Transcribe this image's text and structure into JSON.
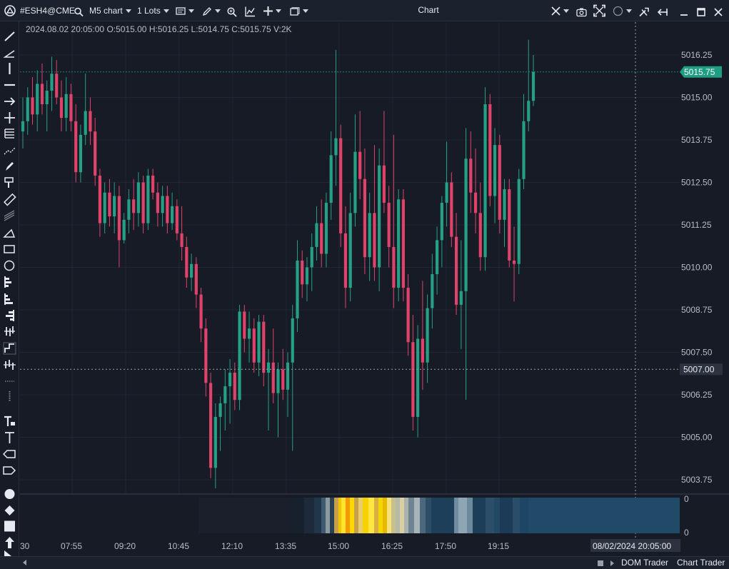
{
  "titlebar": {
    "symbol": "#ESH4@CME",
    "timeframe": "M5 chart",
    "lots": "1 Lots",
    "window_title": "Chart"
  },
  "ohlc_readout": "2024.08.02 20:05:00 O:5015.00 H:5016.25 L:5014.75 C:5015.75 V:2K",
  "price_axis": {
    "ticks": [
      "5016.25",
      "5015.00",
      "5013.75",
      "5012.50",
      "5011.25",
      "5010.00",
      "5008.75",
      "5007.50",
      "5006.25",
      "5005.00",
      "5003.75"
    ],
    "last_price": "5015.75",
    "crosshair_price": "5007.00"
  },
  "time_axis": {
    "ticks": [
      "30",
      "07:55",
      "09:20",
      "10:45",
      "12:10",
      "13:35",
      "15:00",
      "16:25",
      "17:50",
      "19:15"
    ],
    "crosshair_time": "08/02/2024  20:05:00"
  },
  "heatmap_axis": {
    "top": "0",
    "bottom": "0"
  },
  "bottom_tabs": [
    "DOM Trader",
    "Chart Trader"
  ],
  "colors": {
    "up": "#26a085",
    "down": "#e0436a",
    "background": "#161b26",
    "last_price_badge": "#1f9e84"
  },
  "chart_data": {
    "type": "candlestick",
    "ylim": [
      5003.25,
      5016.75
    ],
    "candles_note": "",
    "series": [
      {
        "o": 5014.0,
        "h": 5015.0,
        "l": 5013.5,
        "c": 5014.3
      },
      {
        "o": 5014.3,
        "h": 5015.3,
        "l": 5013.9,
        "c": 5015.0
      },
      {
        "o": 5015.0,
        "h": 5015.6,
        "l": 5014.2,
        "c": 5014.5
      },
      {
        "o": 5014.5,
        "h": 5015.8,
        "l": 5014.0,
        "c": 5015.4
      },
      {
        "o": 5015.4,
        "h": 5016.0,
        "l": 5014.5,
        "c": 5014.8
      },
      {
        "o": 5014.8,
        "h": 5015.5,
        "l": 5014.0,
        "c": 5015.2
      },
      {
        "o": 5015.2,
        "h": 5016.2,
        "l": 5014.6,
        "c": 5015.7
      },
      {
        "o": 5015.7,
        "h": 5016.1,
        "l": 5014.8,
        "c": 5015.0
      },
      {
        "o": 5015.0,
        "h": 5015.5,
        "l": 5014.0,
        "c": 5014.4
      },
      {
        "o": 5014.4,
        "h": 5015.6,
        "l": 5014.0,
        "c": 5015.1
      },
      {
        "o": 5015.1,
        "h": 5015.4,
        "l": 5014.0,
        "c": 5014.3
      },
      {
        "o": 5014.3,
        "h": 5014.8,
        "l": 5012.5,
        "c": 5012.8
      },
      {
        "o": 5012.8,
        "h": 5014.2,
        "l": 5012.5,
        "c": 5013.9
      },
      {
        "o": 5013.9,
        "h": 5015.7,
        "l": 5013.6,
        "c": 5014.6
      },
      {
        "o": 5014.6,
        "h": 5015.0,
        "l": 5013.6,
        "c": 5014.0
      },
      {
        "o": 5014.0,
        "h": 5014.4,
        "l": 5012.4,
        "c": 5012.7
      },
      {
        "o": 5012.7,
        "h": 5012.9,
        "l": 5010.9,
        "c": 5011.3
      },
      {
        "o": 5011.3,
        "h": 5012.5,
        "l": 5011.0,
        "c": 5012.2
      },
      {
        "o": 5012.2,
        "h": 5012.6,
        "l": 5011.2,
        "c": 5011.5
      },
      {
        "o": 5011.5,
        "h": 5012.5,
        "l": 5011.0,
        "c": 5012.1
      },
      {
        "o": 5012.1,
        "h": 5012.4,
        "l": 5010.0,
        "c": 5010.8
      },
      {
        "o": 5010.8,
        "h": 5011.6,
        "l": 5010.7,
        "c": 5011.4
      },
      {
        "o": 5011.4,
        "h": 5012.3,
        "l": 5011.0,
        "c": 5012.0
      },
      {
        "o": 5012.0,
        "h": 5012.6,
        "l": 5011.1,
        "c": 5011.6
      },
      {
        "o": 5011.6,
        "h": 5012.8,
        "l": 5011.2,
        "c": 5012.5
      },
      {
        "o": 5012.5,
        "h": 5012.7,
        "l": 5011.0,
        "c": 5011.3
      },
      {
        "o": 5011.3,
        "h": 5012.9,
        "l": 5011.1,
        "c": 5012.7
      },
      {
        "o": 5012.7,
        "h": 5012.9,
        "l": 5012.0,
        "c": 5012.2
      },
      {
        "o": 5012.2,
        "h": 5012.5,
        "l": 5011.2,
        "c": 5011.6
      },
      {
        "o": 5011.6,
        "h": 5012.4,
        "l": 5011.2,
        "c": 5012.1
      },
      {
        "o": 5012.1,
        "h": 5012.4,
        "l": 5011.0,
        "c": 5011.3
      },
      {
        "o": 5011.3,
        "h": 5012.2,
        "l": 5011.1,
        "c": 5011.8
      },
      {
        "o": 5011.8,
        "h": 5012.0,
        "l": 5010.8,
        "c": 5011.0
      },
      {
        "o": 5011.0,
        "h": 5011.8,
        "l": 5010.2,
        "c": 5010.6
      },
      {
        "o": 5010.6,
        "h": 5010.9,
        "l": 5009.4,
        "c": 5009.7
      },
      {
        "o": 5009.7,
        "h": 5010.4,
        "l": 5009.3,
        "c": 5010.1
      },
      {
        "o": 5010.1,
        "h": 5010.3,
        "l": 5008.8,
        "c": 5009.2
      },
      {
        "o": 5009.2,
        "h": 5009.4,
        "l": 5007.8,
        "c": 5008.2
      },
      {
        "o": 5008.2,
        "h": 5008.5,
        "l": 5006.2,
        "c": 5006.6
      },
      {
        "o": 5006.6,
        "h": 5006.9,
        "l": 5003.8,
        "c": 5004.1
      },
      {
        "o": 5004.1,
        "h": 5006.0,
        "l": 5003.5,
        "c": 5005.6
      },
      {
        "o": 5005.6,
        "h": 5006.2,
        "l": 5004.6,
        "c": 5006.0
      },
      {
        "o": 5006.0,
        "h": 5007.0,
        "l": 5005.2,
        "c": 5006.5
      },
      {
        "o": 5006.5,
        "h": 5007.3,
        "l": 5005.4,
        "c": 5006.9
      },
      {
        "o": 5006.9,
        "h": 5007.2,
        "l": 5005.8,
        "c": 5006.1
      },
      {
        "o": 5006.1,
        "h": 5008.9,
        "l": 5005.8,
        "c": 5008.7
      },
      {
        "o": 5008.7,
        "h": 5008.9,
        "l": 5007.5,
        "c": 5007.9
      },
      {
        "o": 5007.9,
        "h": 5008.7,
        "l": 5007.2,
        "c": 5008.2
      },
      {
        "o": 5008.2,
        "h": 5008.5,
        "l": 5006.9,
        "c": 5007.2
      },
      {
        "o": 5007.2,
        "h": 5008.6,
        "l": 5006.8,
        "c": 5008.4
      },
      {
        "o": 5008.4,
        "h": 5008.6,
        "l": 5006.5,
        "c": 5006.9
      },
      {
        "o": 5006.9,
        "h": 5007.6,
        "l": 5005.2,
        "c": 5007.2
      },
      {
        "o": 5007.2,
        "h": 5008.2,
        "l": 5006.0,
        "c": 5006.3
      },
      {
        "o": 5006.3,
        "h": 5007.2,
        "l": 5005.0,
        "c": 5007.0
      },
      {
        "o": 5007.0,
        "h": 5007.6,
        "l": 5006.1,
        "c": 5006.4
      },
      {
        "o": 5006.4,
        "h": 5007.5,
        "l": 5005.6,
        "c": 5007.2
      },
      {
        "o": 5007.2,
        "h": 5008.9,
        "l": 5004.6,
        "c": 5008.5
      },
      {
        "o": 5008.5,
        "h": 5010.8,
        "l": 5008.1,
        "c": 5010.2
      },
      {
        "o": 5010.2,
        "h": 5010.5,
        "l": 5009.1,
        "c": 5009.5
      },
      {
        "o": 5009.5,
        "h": 5010.3,
        "l": 5009.0,
        "c": 5010.0
      },
      {
        "o": 5010.0,
        "h": 5011.0,
        "l": 5009.3,
        "c": 5010.6
      },
      {
        "o": 5010.6,
        "h": 5011.8,
        "l": 5010.2,
        "c": 5011.3
      },
      {
        "o": 5011.3,
        "h": 5012.0,
        "l": 5010.0,
        "c": 5010.4
      },
      {
        "o": 5010.4,
        "h": 5012.2,
        "l": 5010.0,
        "c": 5011.9
      },
      {
        "o": 5011.9,
        "h": 5014.0,
        "l": 5011.4,
        "c": 5013.3
      },
      {
        "o": 5013.3,
        "h": 5016.4,
        "l": 5012.4,
        "c": 5013.8
      },
      {
        "o": 5013.8,
        "h": 5014.2,
        "l": 5010.6,
        "c": 5011.0
      },
      {
        "o": 5011.0,
        "h": 5011.8,
        "l": 5008.8,
        "c": 5009.4
      },
      {
        "o": 5009.4,
        "h": 5012.2,
        "l": 5009.0,
        "c": 5011.6
      },
      {
        "o": 5011.6,
        "h": 5014.5,
        "l": 5011.2,
        "c": 5013.4
      },
      {
        "o": 5013.4,
        "h": 5014.6,
        "l": 5012.0,
        "c": 5012.6
      },
      {
        "o": 5012.6,
        "h": 5013.5,
        "l": 5009.8,
        "c": 5010.3
      },
      {
        "o": 5010.3,
        "h": 5012.2,
        "l": 5009.6,
        "c": 5011.6
      },
      {
        "o": 5011.6,
        "h": 5013.6,
        "l": 5009.6,
        "c": 5010.0
      },
      {
        "o": 5010.0,
        "h": 5013.5,
        "l": 5009.3,
        "c": 5013.0
      },
      {
        "o": 5013.0,
        "h": 5014.6,
        "l": 5011.6,
        "c": 5011.9
      },
      {
        "o": 5011.9,
        "h": 5012.4,
        "l": 5010.0,
        "c": 5010.6
      },
      {
        "o": 5010.6,
        "h": 5013.9,
        "l": 5008.8,
        "c": 5009.4
      },
      {
        "o": 5009.4,
        "h": 5012.3,
        "l": 5009.0,
        "c": 5012.0
      },
      {
        "o": 5012.0,
        "h": 5012.3,
        "l": 5009.0,
        "c": 5009.4
      },
      {
        "o": 5009.4,
        "h": 5009.8,
        "l": 5007.4,
        "c": 5007.8
      },
      {
        "o": 5007.8,
        "h": 5008.6,
        "l": 5005.2,
        "c": 5005.6
      },
      {
        "o": 5005.6,
        "h": 5008.3,
        "l": 5005.0,
        "c": 5007.9
      },
      {
        "o": 5007.9,
        "h": 5009.6,
        "l": 5006.4,
        "c": 5007.2
      },
      {
        "o": 5007.2,
        "h": 5009.2,
        "l": 5006.6,
        "c": 5008.8
      },
      {
        "o": 5008.8,
        "h": 5010.4,
        "l": 5008.2,
        "c": 5009.8
      },
      {
        "o": 5009.8,
        "h": 5011.2,
        "l": 5009.2,
        "c": 5010.8
      },
      {
        "o": 5010.8,
        "h": 5012.1,
        "l": 5010.0,
        "c": 5011.9
      },
      {
        "o": 5011.9,
        "h": 5013.7,
        "l": 5011.2,
        "c": 5012.5
      },
      {
        "o": 5012.5,
        "h": 5012.8,
        "l": 5010.6,
        "c": 5010.9
      },
      {
        "o": 5010.9,
        "h": 5011.6,
        "l": 5008.6,
        "c": 5008.9
      },
      {
        "o": 5008.9,
        "h": 5010.8,
        "l": 5007.6,
        "c": 5009.3
      },
      {
        "o": 5009.3,
        "h": 5014.1,
        "l": 5006.1,
        "c": 5013.2
      },
      {
        "o": 5013.2,
        "h": 5014.0,
        "l": 5011.6,
        "c": 5012.2
      },
      {
        "o": 5012.2,
        "h": 5013.5,
        "l": 5011.0,
        "c": 5011.6
      },
      {
        "o": 5011.6,
        "h": 5012.5,
        "l": 5009.9,
        "c": 5010.3
      },
      {
        "o": 5010.3,
        "h": 5015.3,
        "l": 5009.9,
        "c": 5014.8
      },
      {
        "o": 5014.8,
        "h": 5015.1,
        "l": 5011.8,
        "c": 5012.1
      },
      {
        "o": 5012.1,
        "h": 5014.1,
        "l": 5011.3,
        "c": 5013.6
      },
      {
        "o": 5013.6,
        "h": 5013.9,
        "l": 5011.0,
        "c": 5011.4
      },
      {
        "o": 5011.4,
        "h": 5012.6,
        "l": 5010.6,
        "c": 5012.3
      },
      {
        "o": 5012.3,
        "h": 5012.6,
        "l": 5010.0,
        "c": 5010.2
      },
      {
        "o": 5010.2,
        "h": 5011.2,
        "l": 5009.0,
        "c": 5010.1
      },
      {
        "o": 5010.1,
        "h": 5012.9,
        "l": 5009.8,
        "c": 5012.6
      },
      {
        "o": 5012.6,
        "h": 5015.1,
        "l": 5012.3,
        "c": 5014.3
      },
      {
        "o": 5014.3,
        "h": 5016.7,
        "l": 5014.0,
        "c": 5014.9
      },
      {
        "o": 5014.9,
        "h": 5016.25,
        "l": 5014.75,
        "c": 5015.75
      }
    ]
  }
}
